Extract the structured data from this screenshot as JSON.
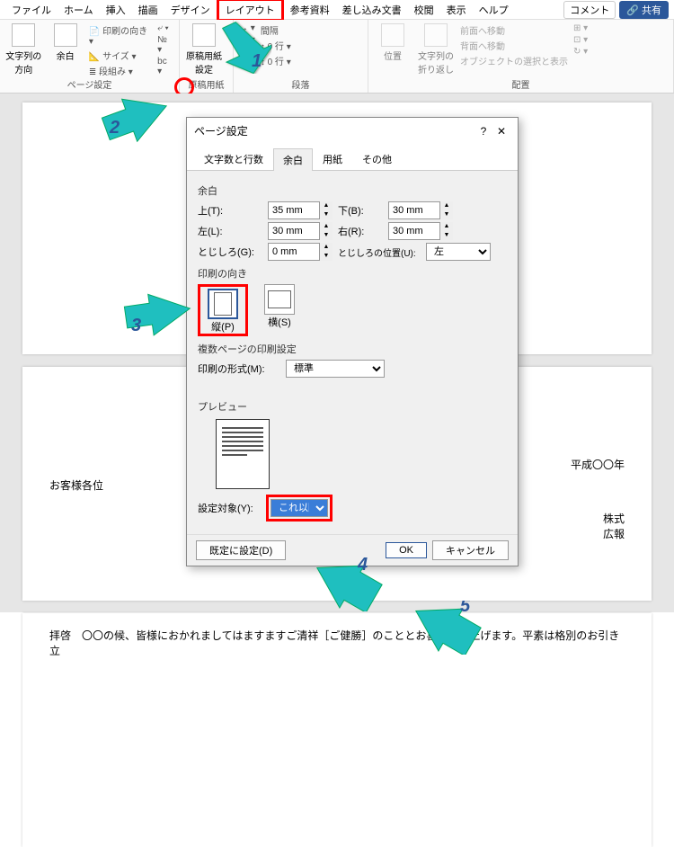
{
  "menubar": {
    "tabs": [
      "ファイル",
      "ホーム",
      "挿入",
      "描画",
      "デザイン",
      "レイアウト",
      "参考資料",
      "差し込み文書",
      "校閲",
      "表示",
      "ヘルプ"
    ],
    "comment": "コメント",
    "share": "共有"
  },
  "ribbon": {
    "group1": {
      "textDir": "文字列の方向",
      "margin": "余白",
      "items": [
        "印刷の向き",
        "サイズ",
        "段組み"
      ],
      "title": "ページ設定"
    },
    "group2": {
      "button": "原稿用紙設定",
      "title": "原稿用紙"
    },
    "group3": {
      "title": "段落",
      "spacing": "間隔",
      "val": "0 行"
    },
    "group4": {
      "pos": "位置",
      "wrap": "文字列の折り返し",
      "a": "前面へ移動",
      "b": "背面へ移動",
      "c": "オブジェクトの選択と表示",
      "title": "配置"
    }
  },
  "dialog": {
    "title": "ページ設定",
    "tabs": [
      "文字数と行数",
      "余白",
      "用紙",
      "その他"
    ],
    "margin_h": "余白",
    "top_l": "上(T):",
    "top_v": "35 mm",
    "bottom_l": "下(B):",
    "bottom_v": "30 mm",
    "left_l": "左(L):",
    "left_v": "30 mm",
    "right_l": "右(R):",
    "right_v": "30 mm",
    "gutter_l": "とじしろ(G):",
    "gutter_v": "0 mm",
    "gutterpos_l": "とじしろの位置(U):",
    "gutterpos_v": "左",
    "orient_h": "印刷の向き",
    "orient_p": "縦(P)",
    "orient_l": "横(S)",
    "multi_h": "複数ページの印刷設定",
    "multi_l": "印刷の形式(M):",
    "multi_v": "標準",
    "preview_h": "プレビュー",
    "apply_l": "設定対象(Y):",
    "apply_v": "これ以降",
    "default_btn": "既定に設定(D)",
    "ok": "OK",
    "cancel": "キャンセル"
  },
  "doc": {
    "date": "平成〇〇年",
    "addr": "お客様各位",
    "comp": "株式",
    "dept": "広報",
    "body": "拝啓　〇〇の候、皆様におかれましてはますますご清祥［ご健勝］のこととお喜び申し上げます。平素は格別のお引き立"
  },
  "callouts": {
    "1": "1",
    "2": "2",
    "3": "3",
    "4": "4",
    "5": "5"
  }
}
